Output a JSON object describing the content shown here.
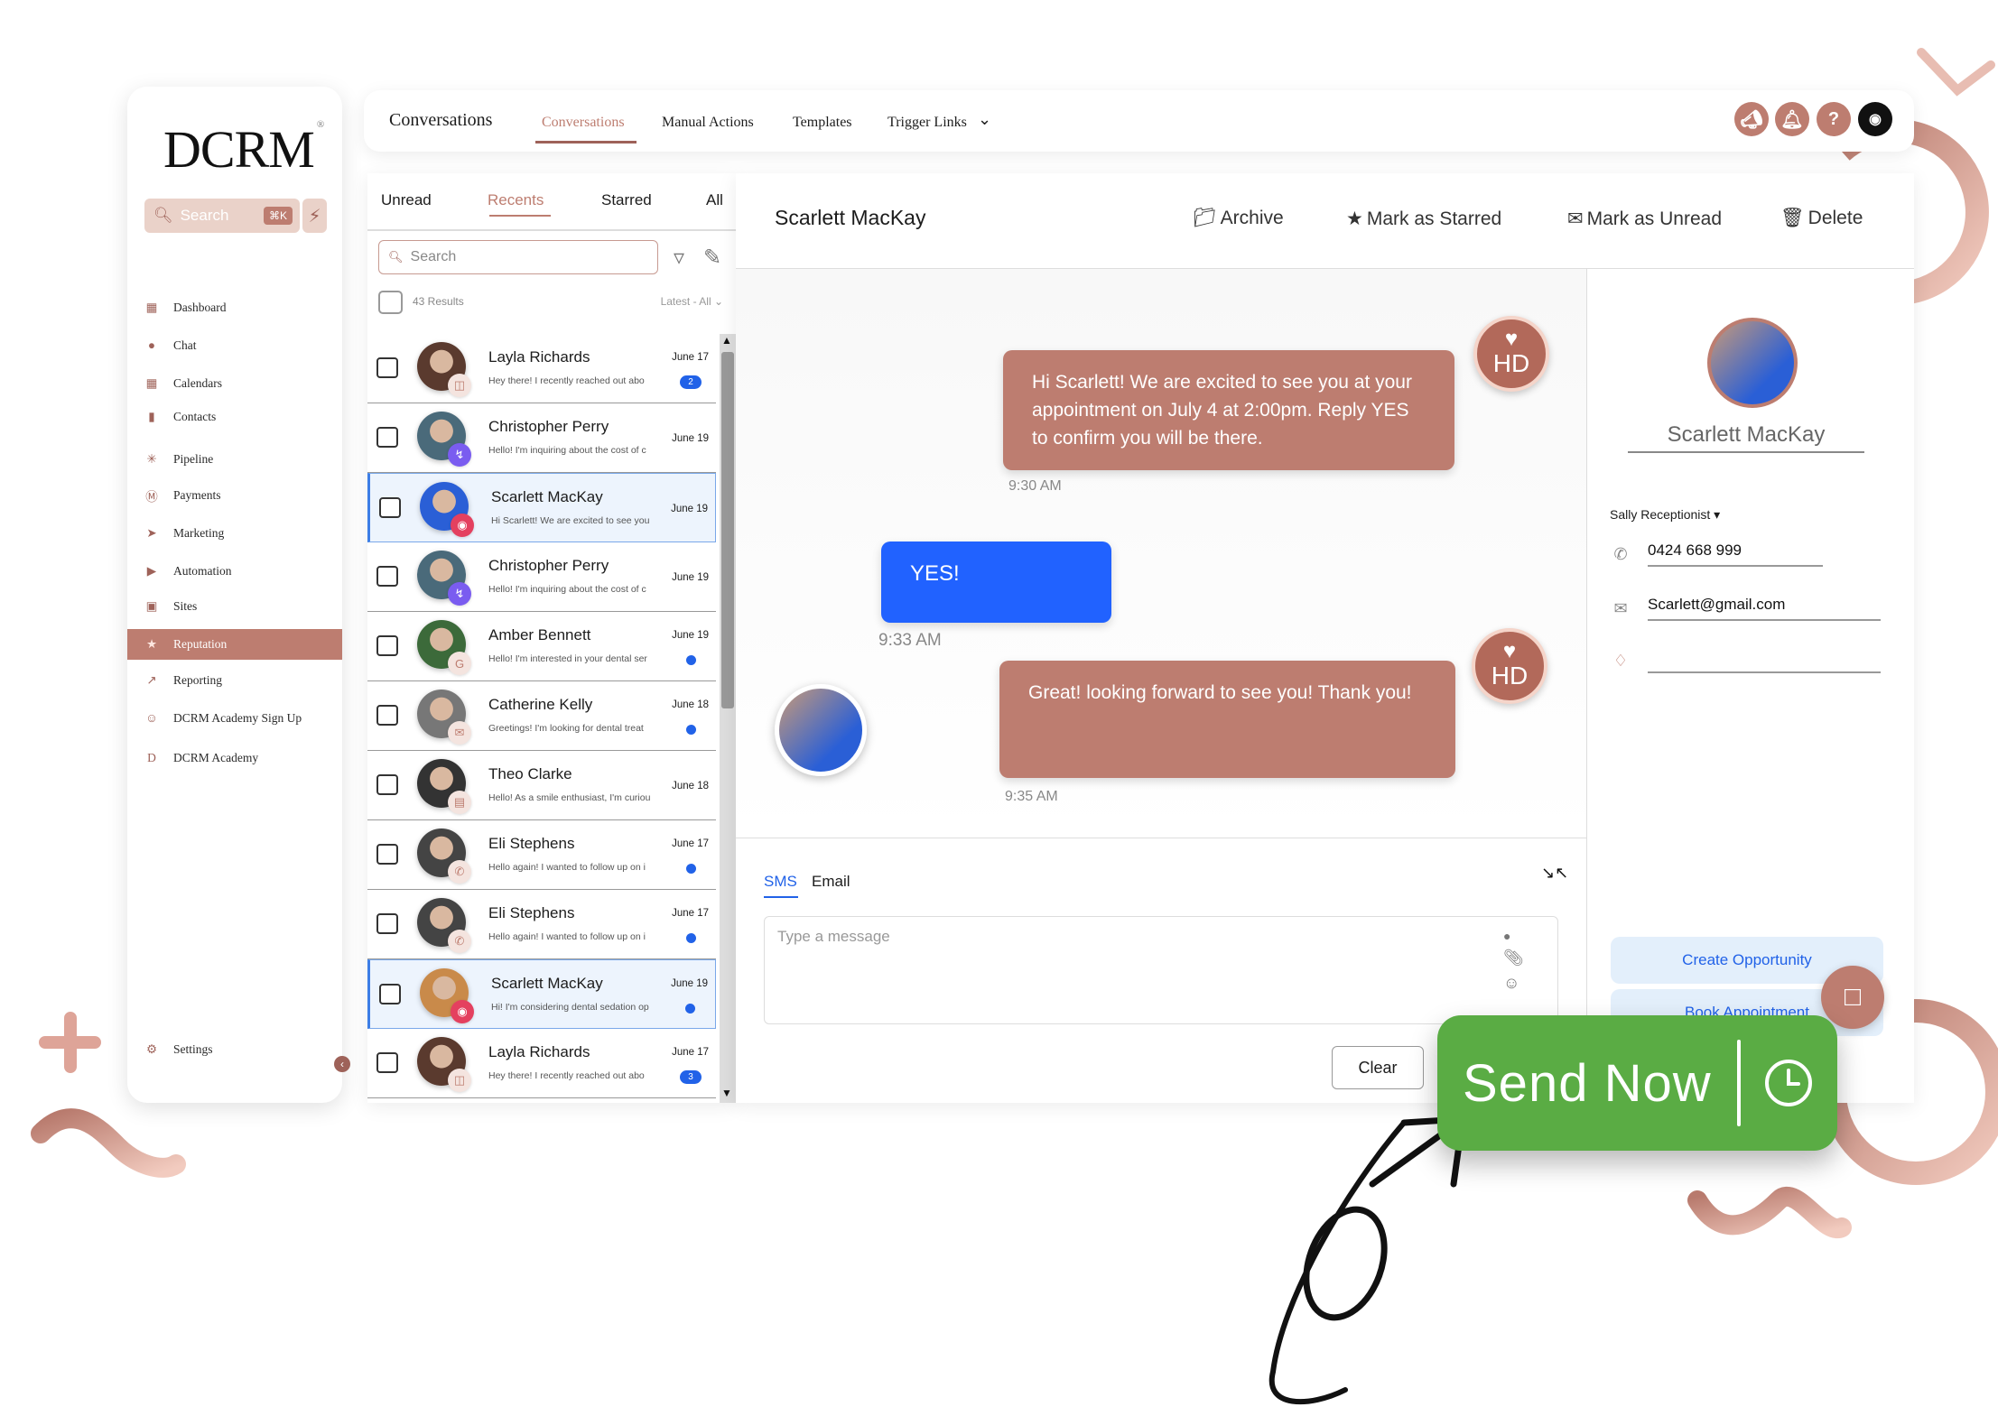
{
  "sidebar": {
    "logo": "DCRM",
    "search_placeholder": "Search",
    "search_shortcut": "⌘K",
    "items": [
      {
        "label": "Dashboard",
        "icon": "dashboard-icon",
        "active": false
      },
      {
        "label": "Chat",
        "icon": "chat-icon",
        "active": false
      },
      {
        "label": "Calendars",
        "icon": "calendar-icon",
        "active": false
      },
      {
        "label": "Contacts",
        "icon": "contacts-icon",
        "active": false
      },
      {
        "label": "Pipeline",
        "icon": "pipeline-icon",
        "active": false
      },
      {
        "label": "Payments",
        "icon": "payments-icon",
        "active": false
      },
      {
        "label": "Marketing",
        "icon": "marketing-icon",
        "active": false
      },
      {
        "label": "Automation",
        "icon": "automation-icon",
        "active": false
      },
      {
        "label": "Sites",
        "icon": "sites-icon",
        "active": false
      },
      {
        "label": "Reputation",
        "icon": "star-icon",
        "active": true
      },
      {
        "label": "Reporting",
        "icon": "reporting-icon",
        "active": false
      },
      {
        "label": "DCRM Academy Sign Up",
        "icon": "academy-signup-icon",
        "active": false
      },
      {
        "label": "DCRM Academy",
        "icon": "academy-icon",
        "active": false
      }
    ],
    "settings_label": "Settings"
  },
  "topbar": {
    "title": "Conversations",
    "tabs": [
      {
        "label": "Conversations",
        "active": true
      },
      {
        "label": "Manual Actions",
        "active": false
      },
      {
        "label": "Templates",
        "active": false
      },
      {
        "label": "Trigger Links",
        "active": false
      }
    ],
    "icons": [
      "megaphone-icon",
      "bell-icon",
      "help-icon",
      "user-avatar"
    ]
  },
  "list": {
    "tabs": [
      {
        "label": "Unread",
        "active": false
      },
      {
        "label": "Recents",
        "active": true
      },
      {
        "label": "Starred",
        "active": false
      },
      {
        "label": "All",
        "active": false
      }
    ],
    "search_placeholder": "Search",
    "results": "43 Results",
    "sort": "Latest - All",
    "conversations": [
      {
        "name": "Layla Richards",
        "preview": "Hey there! I recently reached out abo",
        "date": "June 17",
        "channel": "video",
        "unread_count": "2",
        "selected": false
      },
      {
        "name": "Christopher Perry",
        "preview": "Hello! I'm inquiring about the cost of c",
        "date": "June 19",
        "channel": "messenger",
        "selected": false
      },
      {
        "name": "Scarlett MacKay",
        "preview": "Hi Scarlett! We are excited to see you",
        "date": "June 19",
        "channel": "instagram",
        "selected": true
      },
      {
        "name": "Christopher Perry",
        "preview": "Hello! I'm inquiring about the cost of c",
        "date": "June 19",
        "channel": "messenger",
        "selected": false
      },
      {
        "name": "Amber Bennett",
        "preview": "Hello! I'm interested in your dental ser",
        "date": "June 19",
        "channel": "google",
        "unread_dot": true,
        "selected": false
      },
      {
        "name": "Catherine Kelly",
        "preview": "Greetings! I'm looking for dental treat",
        "date": "June 18",
        "channel": "email",
        "unread_dot": true,
        "selected": false
      },
      {
        "name": "Theo Clarke",
        "preview": "Hello! As a smile enthusiast, I'm curiou",
        "date": "June 18",
        "channel": "sms",
        "selected": false
      },
      {
        "name": "Eli Stephens",
        "preview": "Hello again! I wanted to follow up on i",
        "date": "June 17",
        "channel": "phone",
        "unread_dot": true,
        "selected": false
      },
      {
        "name": "Eli Stephens",
        "preview": "Hello again! I wanted to follow up on i",
        "date": "June 17",
        "channel": "phone",
        "unread_dot": true,
        "selected": false
      },
      {
        "name": "Scarlett MacKay",
        "preview": "Hi! I'm considering dental sedation op",
        "date": "June 19",
        "channel": "instagram",
        "unread_dot": true,
        "selected": true
      },
      {
        "name": "Layla Richards",
        "preview": "Hey there! I recently reached out abo",
        "date": "June 17",
        "channel": "video",
        "unread_count": "3",
        "selected": false
      }
    ]
  },
  "chat": {
    "contact_name": "Scarlett MacKay",
    "actions": [
      {
        "label": "Archive",
        "icon": "folder-icon"
      },
      {
        "label": "Mark as Starred",
        "icon": "star-icon"
      },
      {
        "label": "Mark as Unread",
        "icon": "envelope-icon"
      },
      {
        "label": "Delete",
        "icon": "trash-icon"
      }
    ],
    "messages": [
      {
        "direction": "outbound",
        "text": "Hi Scarlett! We are excited to see you at your appointment on July 4 at 2:00pm. Reply YES to confirm you will be there.",
        "time": "9:30 AM",
        "avatar": "HD"
      },
      {
        "direction": "inbound",
        "text": "YES!",
        "time": "9:33 AM"
      },
      {
        "direction": "outbound",
        "text": "Great! looking forward to see you! Thank you!",
        "time": "9:35 AM",
        "avatar": "HD"
      }
    ],
    "compose": {
      "tabs": [
        {
          "label": "SMS",
          "active": true
        },
        {
          "label": "Email",
          "active": false
        }
      ],
      "placeholder": "Type a message",
      "clear_label": "Clear",
      "send_label": "Send Now"
    }
  },
  "contact": {
    "name": "Scarlett MacKay",
    "owner": "Sally Receptionist",
    "phone": "0424 668 999",
    "email": "Scarlett@gmail.com",
    "tags": "",
    "buttons": [
      "Create Opportunity",
      "Book Appointment"
    ]
  },
  "colors": {
    "brand": "#bd7d70",
    "brand_dark": "#9e6259",
    "accent_blue": "#2162e8",
    "send_green": "#5aac44"
  }
}
